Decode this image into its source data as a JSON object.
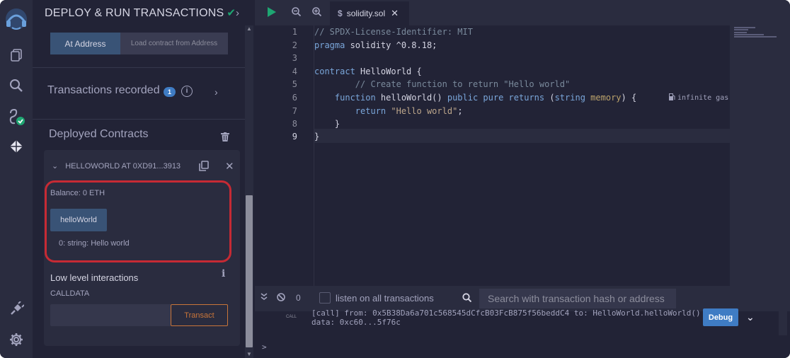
{
  "panel": {
    "title": "DEPLOY & RUN TRANSACTIONS",
    "title_check": "✔",
    "chevron": "›",
    "at_address_label": "At Address",
    "load_contract_label": "Load contract from Address",
    "transactions_recorded": "Transactions recorded",
    "transactions_count": "1",
    "info_glyph": "i",
    "deployed_contracts": "Deployed Contracts",
    "contract": {
      "caret": "⌄",
      "name": "HELLOWORLD AT 0XD91...3913",
      "close": "✕",
      "balance": "Balance: 0 ETH",
      "function_button": "helloWorld",
      "result": "0: string: Hello world",
      "low_level_title": "Low level interactions",
      "low_level_info": "i",
      "calldata_label": "CALLDATA",
      "calldata_value": "",
      "transact_label": "Transact"
    }
  },
  "tabs": {
    "file_icon": "$",
    "file_name": "solidity.sol",
    "close": "✕"
  },
  "editor": {
    "line_numbers": [
      "1",
      "2",
      "3",
      "4",
      "5",
      "6",
      "7",
      "8",
      "9"
    ],
    "lines": {
      "l1": "// SPDX-License-Identifier: MIT",
      "l2_kw": "pragma",
      "l2_rest": " solidity ^0.8.18;",
      "l4_kw": "contract",
      "l4_rest": " HelloWorld {",
      "l5": "        // Create function to return \"Hello world\"",
      "l6_kw1": "    function",
      "l6_name": " helloWorld()",
      "l6_kw2": " public pure returns",
      "l6_p1": " (",
      "l6_ty": "string",
      "l6_sp": " ",
      "l6_mem": "memory",
      "l6_p2": ") {",
      "l7_kw": "        return",
      "l7_str": " \"Hello world\"",
      "l7_end": ";",
      "l8": "    }",
      "l9": "}"
    },
    "gas_hint": "infinite gas"
  },
  "terminal": {
    "tx_count": "0",
    "listen_label": "listen on all transactions",
    "search_placeholder": "Search with transaction hash or address",
    "call_tag": "CALL",
    "line1": "[call] from: 0x5B38Da6a701c568545dCfcB03FcB875f56beddC4 to: HelloWorld.helloWorld()",
    "line2": "data: 0xc60...5f76c",
    "debug_label": "Debug",
    "caret": "⌄",
    "prompt": ">"
  },
  "colors": {
    "accent_green": "#1ea672",
    "accent_blue": "#3f7cc4",
    "highlight_red": "#c62a34",
    "transact_orange": "#c97539"
  }
}
